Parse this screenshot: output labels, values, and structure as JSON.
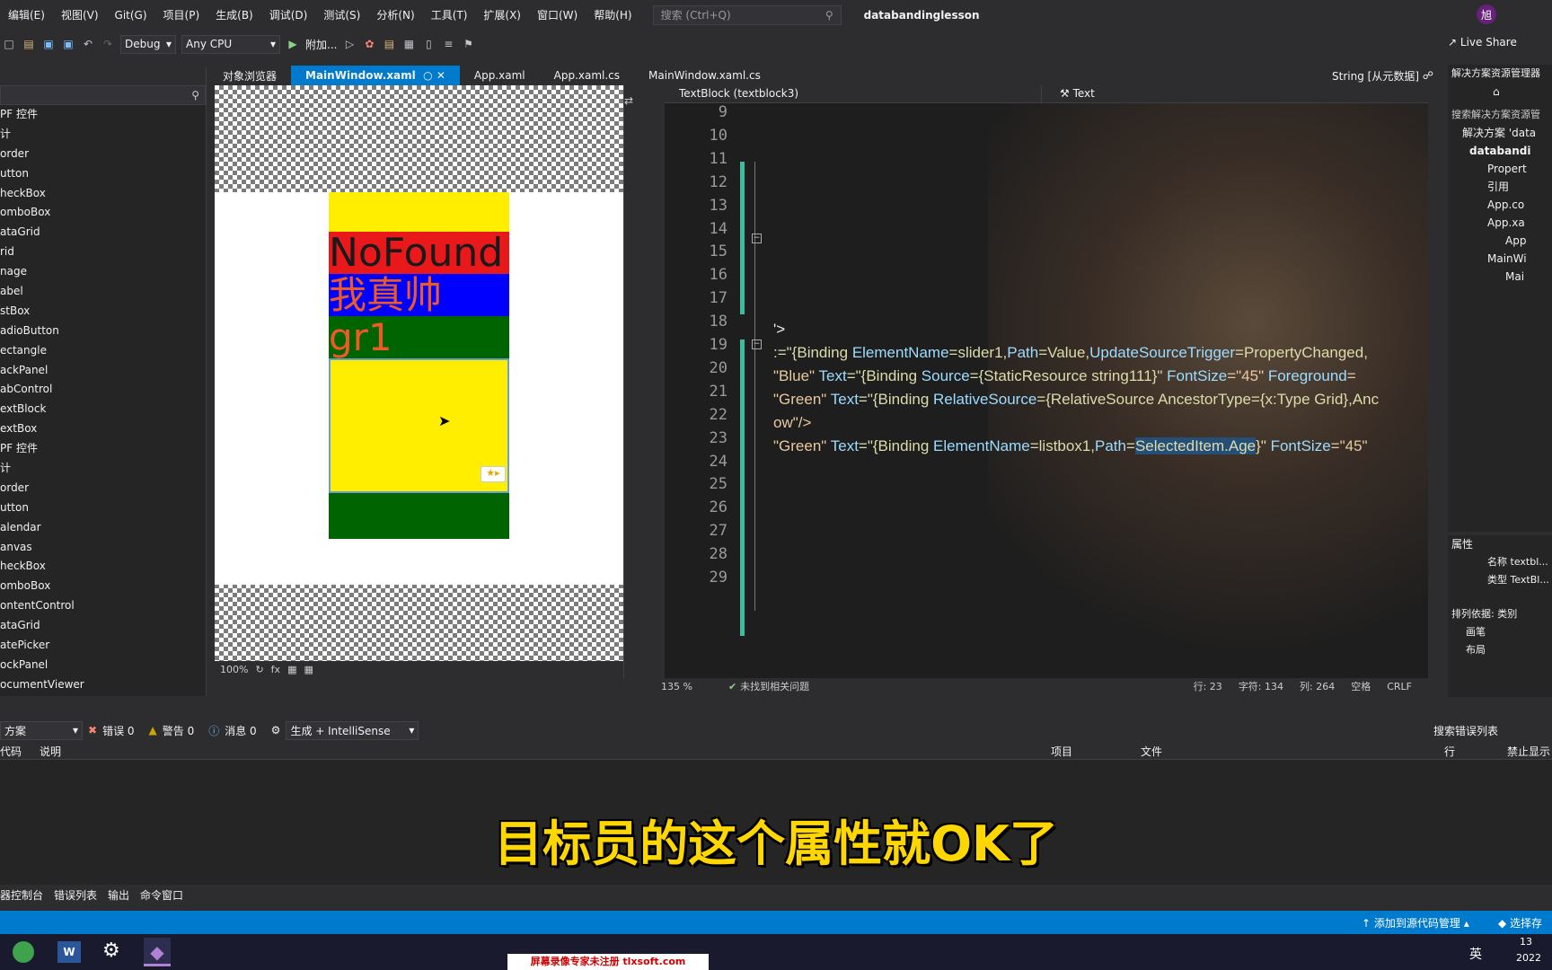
{
  "menu": [
    "编辑(E)",
    "视图(V)",
    "Git(G)",
    "项目(P)",
    "生成(B)",
    "调试(D)",
    "测试(S)",
    "分析(N)",
    "工具(T)",
    "扩展(X)",
    "窗口(W)",
    "帮助(H)"
  ],
  "search_placeholder": "搜索 (Ctrl+Q)",
  "solution_title": "databandinglesson",
  "avatar": "旭",
  "toolbar": {
    "config": "Debug",
    "platform": "Any CPU",
    "run_label": "附加...",
    "live_share": "Live Share"
  },
  "toolbox": {
    "items": [
      "PF 控件",
      "计",
      "order",
      "utton",
      "heckBox",
      "omboBox",
      "ataGrid",
      "rid",
      "nage",
      "abel",
      "stBox",
      "adioButton",
      "ectangle",
      "ackPanel",
      "abControl",
      "extBlock",
      "extBox",
      "PF 控件",
      "计",
      "order",
      "utton",
      "alendar",
      "anvas",
      "heckBox",
      "omboBox",
      "ontentControl",
      "ataGrid",
      "atePicker",
      "ockPanel",
      "ocumentViewer"
    ]
  },
  "doc_tabs": [
    {
      "label": "对象浏览器",
      "active": false
    },
    {
      "label": "MainWindow.xaml",
      "active": true
    },
    {
      "label": "App.xaml",
      "active": false
    },
    {
      "label": "App.xaml.cs",
      "active": false
    },
    {
      "label": "MainWindow.xaml.cs",
      "active": false
    }
  ],
  "tab_right_label": "String [从元数据]",
  "designer": {
    "blocks": [
      {
        "text": "",
        "color": "#ffee00"
      },
      {
        "text": "NoFound",
        "color": "#e8181b",
        "fg": "#1a1a1a"
      },
      {
        "text": "我真帅",
        "color": "#0000ff",
        "fg": "#ee5a24"
      },
      {
        "text": "gr1",
        "color": "#006400",
        "fg": "#ee5a24"
      },
      {
        "text": "",
        "color": "#ffee00"
      },
      {
        "text": "",
        "color": "#006400"
      }
    ],
    "zoom": "100%"
  },
  "editor": {
    "element_combo": "TextBlock (textblock3)",
    "property_combo": "Text",
    "zoom": "135 %",
    "issues": "未找到相关问题",
    "pos": {
      "line": "行: 23",
      "char": "字符: 134",
      "col": "列: 264",
      "space": "空格",
      "eol": "CRLF"
    },
    "line_numbers": [
      "9",
      "10",
      "11",
      "12",
      "13",
      "14",
      "15",
      "16",
      "17",
      "18",
      "19",
      "20",
      "21",
      "22",
      "23",
      "24",
      "25",
      "26",
      "27",
      "28",
      "29"
    ],
    "lines": {
      "l18": "'>",
      "l19a": ":=\"{Binding ",
      "l19b": "ElementName",
      "l19c": "=slider1,",
      "l19d": "Path",
      "l19e": "=Value,",
      "l19f": "UpdateSourceTrigger",
      "l19g": "=PropertyChanged,",
      "l20a": "\"Blue\" ",
      "l20b": "Text",
      "l20c": "=\"{Binding ",
      "l20d": "Source",
      "l20e": "={StaticResource string111}\" ",
      "l20f": "FontSize",
      "l20g": "=\"45\" ",
      "l20h": "Foreground",
      "l20i": "=",
      "l21a": "\"Green\" ",
      "l21b": "Text",
      "l21c": "=\"{Binding ",
      "l21d": "RelativeSource",
      "l21e": "={RelativeSource AncestorType={x:Type Grid},Anc",
      "l22": "ow\"/>",
      "l23a": "\"Green\" ",
      "l23b": "Text",
      "l23c": "=\"{Binding ",
      "l23d": "ElementName",
      "l23e": "=listbox1,",
      "l23f": "Path",
      "l23g": "=",
      "l23h": "SelectedItem.Age",
      "l23i": "}\" ",
      "l23j": "FontSize",
      "l23k": "=\"45\""
    }
  },
  "solution_explorer": {
    "title": "解决方案资源管理器",
    "search": "搜索解决方案资源管",
    "items": [
      "解决方案 'data",
      "databandi",
      "Propert",
      "引用",
      "App.co",
      "App.xa",
      "App",
      "MainWi",
      "Mai"
    ]
  },
  "properties": {
    "title": "属性",
    "name_label": "名称",
    "name_value": "textbl...",
    "type_label": "类型",
    "type_value": "TextBl...",
    "sort": "排列依据: 类别",
    "cat1": "画笔",
    "cat2": "布局"
  },
  "error_list": {
    "scope": "方案",
    "errors": "错误 0",
    "warnings": "警告 0",
    "messages": "消息 0",
    "filter": "生成 + IntelliSense",
    "search": "搜索错误列表",
    "cols": [
      "代码",
      "说明",
      "项目",
      "文件",
      "行",
      "禁止显示"
    ]
  },
  "bottom_tabs": [
    "器控制台",
    "错误列表",
    "输出",
    "命令窗口"
  ],
  "status": {
    "add_source": "添加到源代码管理",
    "select": "选择存"
  },
  "taskbar": {
    "ime": "英",
    "time": "13",
    "date": "2022"
  },
  "subtitle": "目标员的这个属性就OK了",
  "watermark": "屏幕录像专家未注册 tlxsoft.com"
}
